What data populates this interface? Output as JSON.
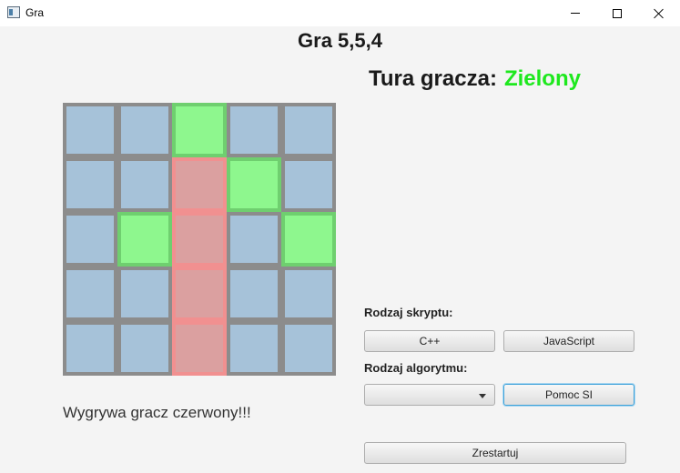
{
  "window": {
    "title": "Gra"
  },
  "game_title": "Gra 5,5,4",
  "turn": {
    "label": "Tura gracza:",
    "player": "Zielony"
  },
  "board": {
    "rows": 5,
    "cols": 5,
    "cells": [
      [
        "empty",
        "empty",
        "green",
        "empty",
        "empty"
      ],
      [
        "empty",
        "empty",
        "red",
        "green",
        "empty"
      ],
      [
        "empty",
        "green",
        "red",
        "empty",
        "green"
      ],
      [
        "empty",
        "empty",
        "red",
        "empty",
        "empty"
      ],
      [
        "empty",
        "empty",
        "red",
        "empty",
        "empty"
      ]
    ]
  },
  "result_text": "Wygrywa gracz czerwony!!!",
  "script_section": {
    "label": "Rodzaj skryptu:",
    "cpp": "C++",
    "js": "JavaScript"
  },
  "algorithm_section": {
    "label": "Rodzaj algorytmu:",
    "selected": "",
    "help_button": "Pomoc SI"
  },
  "restart_button": "Zrestartuj",
  "colors": {
    "green_player": "#1ee81e",
    "empty_cell": "#a6c2d9",
    "green_cell": "#8ef78e",
    "red_cell": "#dba0a0",
    "grid": "#8c8c8c"
  }
}
